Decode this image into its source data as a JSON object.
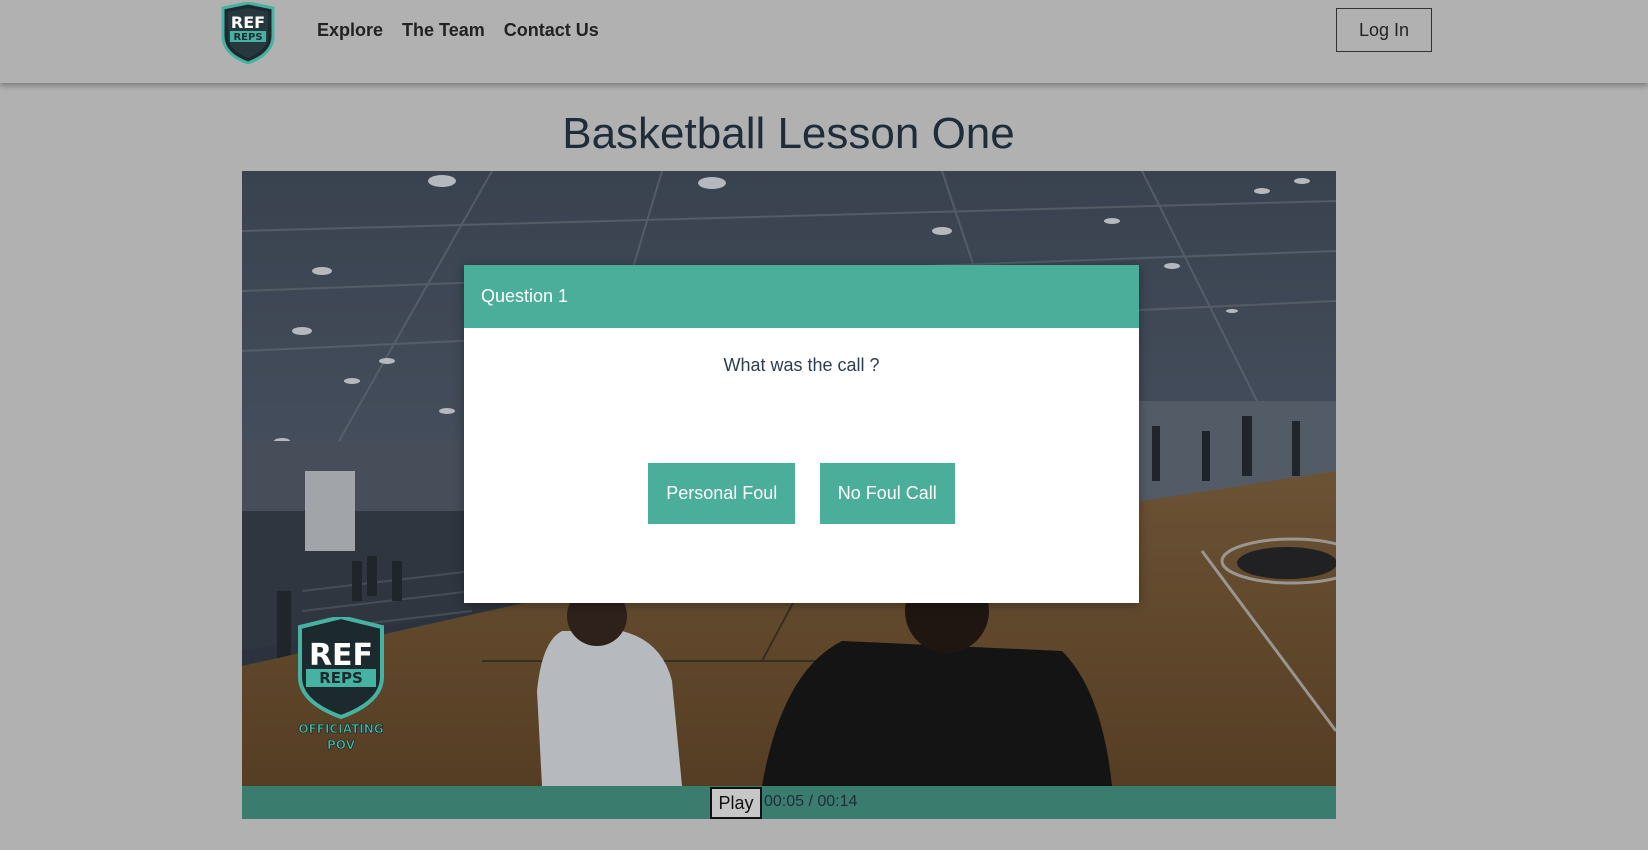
{
  "nav": {
    "links": [
      "Explore",
      "The Team",
      "Contact Us"
    ],
    "login_label": "Log In",
    "logo_text": {
      "top": "REF",
      "bottom": "REPS"
    }
  },
  "page": {
    "title": "Basketball Lesson One"
  },
  "modal": {
    "header": "Question 1",
    "question": "What was the call ?",
    "answers": [
      "Personal Foul",
      "No Foul Call"
    ]
  },
  "video": {
    "watermark": {
      "top": "REF",
      "middle": "REPS",
      "line1": "OFFICIATING",
      "line2": "POV"
    },
    "play_label": "Play",
    "time": "00:05 / 00:14"
  },
  "colors": {
    "accent": "#4aae9a",
    "controls_bar": "#3a7c6e",
    "page_bg": "#b1b1b1"
  },
  "icons": {
    "logo": "ref-reps-shield-icon"
  }
}
